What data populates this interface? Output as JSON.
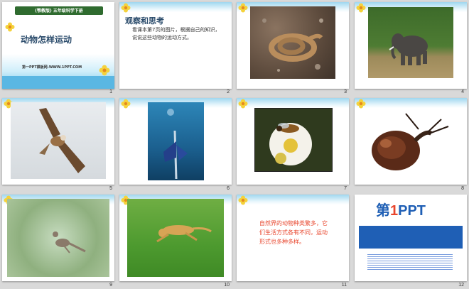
{
  "slides": [
    {
      "num": "1",
      "title": "动物怎样运动",
      "banner": "(鄂教版) 五年级科学下册",
      "footer": "第一PPT模板网-WWW.1PPT.COM"
    },
    {
      "num": "2",
      "heading": "观察和思考",
      "text": "看课本第7页的图片，根据自己的知识，说说这些动物的运动方式。"
    },
    {
      "num": "3"
    },
    {
      "num": "4"
    },
    {
      "num": "5"
    },
    {
      "num": "6"
    },
    {
      "num": "7"
    },
    {
      "num": "8"
    },
    {
      "num": "9"
    },
    {
      "num": "10"
    },
    {
      "num": "11",
      "text": "自然界的动物种类繁多，它们生活方式各有不同，运动形式也多种多样。"
    },
    {
      "num": "12",
      "logo_prefix": "第",
      "logo_digit": "1",
      "logo_suffix": "PPT"
    }
  ],
  "colors": {
    "accent_red": "#e8452c",
    "title_blue": "#2a4b6b",
    "sky": "#9fd7ef"
  }
}
